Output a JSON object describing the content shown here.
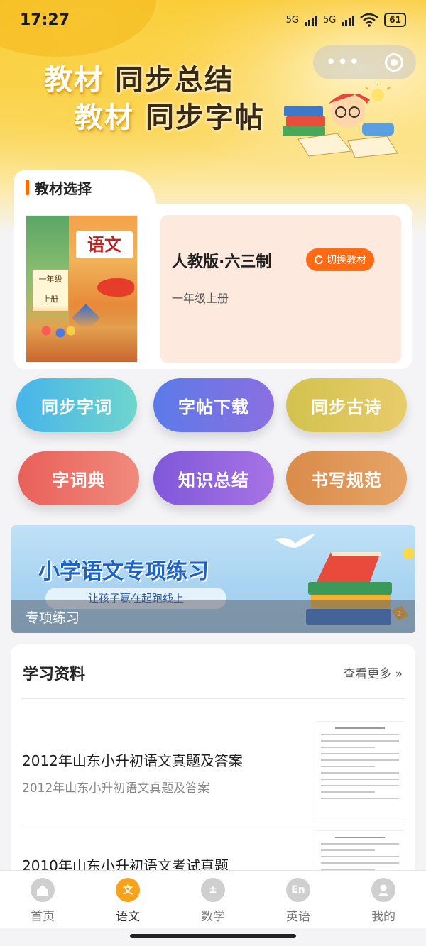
{
  "status_bar": {
    "time": "17:27",
    "network1": "5G",
    "network2": "5G",
    "battery": "61"
  },
  "hero": {
    "slogan1_a": "教材",
    "slogan1_b": "同步总结",
    "slogan2_a": "教材",
    "slogan2_b": "同步字帖"
  },
  "textbook": {
    "section_label": "教材选择",
    "cover_title": "语文",
    "cover_grade": "一年级",
    "cover_volume": "上册",
    "edition": "人教版·六三制",
    "switch_label": "切换教材",
    "grade": "一年级上册"
  },
  "features": [
    {
      "label": "同步字词"
    },
    {
      "label": "字帖下载"
    },
    {
      "label": "同步古诗"
    },
    {
      "label": "字词典"
    },
    {
      "label": "知识总结"
    },
    {
      "label": "书写规范"
    }
  ],
  "banner": {
    "title": "小学语文专项练习",
    "subtitle": "让孩子赢在起跑线上",
    "caption": "专项练习"
  },
  "study": {
    "heading": "学习资料",
    "more": "查看更多 »",
    "items": [
      {
        "title": "2012年山东小升初语文真题及答案",
        "subtitle": "2012年山东小升初语文真题及答案"
      },
      {
        "title": "2010年山东小升初语文考试真题",
        "subtitle": ""
      }
    ]
  },
  "nav": {
    "items": [
      {
        "label": "首页",
        "icon": "home-icon"
      },
      {
        "label": "语文",
        "icon": "chinese-icon",
        "active": true
      },
      {
        "label": "数学",
        "icon": "math-icon"
      },
      {
        "label": "英语",
        "icon": "english-icon"
      },
      {
        "label": "我的",
        "icon": "profile-icon"
      }
    ]
  },
  "colors": {
    "accent": "#ff6a12",
    "active_tab": "#f7a21b",
    "brand_yellow": "#f9c21b"
  }
}
